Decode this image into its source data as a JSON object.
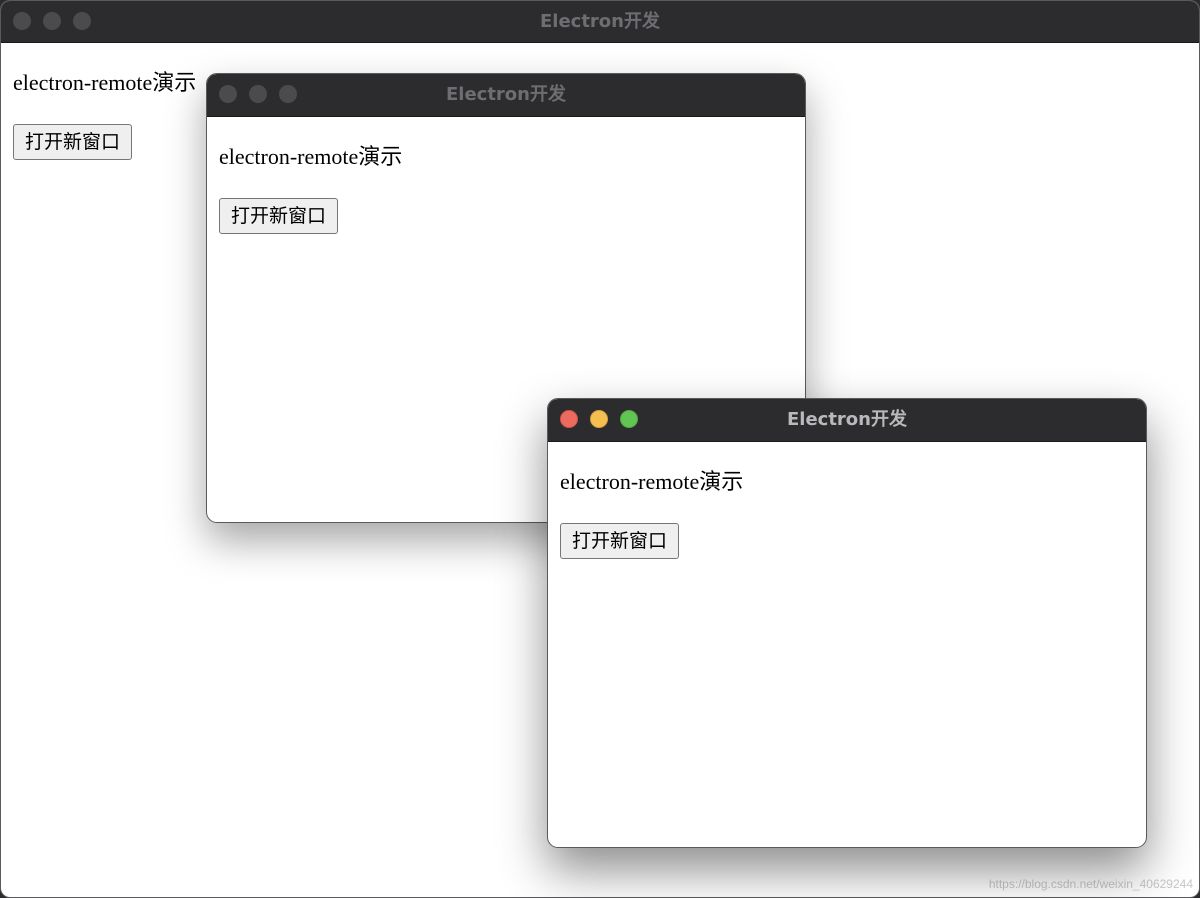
{
  "windows": [
    {
      "title": "Electron开发",
      "heading": "electron-remote演示",
      "button_label": "打开新窗口",
      "active": false
    },
    {
      "title": "Electron开发",
      "heading": "electron-remote演示",
      "button_label": "打开新窗口",
      "active": false
    },
    {
      "title": "Electron开发",
      "heading": "electron-remote演示",
      "button_label": "打开新窗口",
      "active": true
    }
  ],
  "traffic_light_colors": {
    "close": "#ed6a5e",
    "minimize": "#f5bf4f",
    "maximize": "#61c554",
    "inactive": "#4b4b4e"
  },
  "watermark": "https://blog.csdn.net/weixin_40629244"
}
